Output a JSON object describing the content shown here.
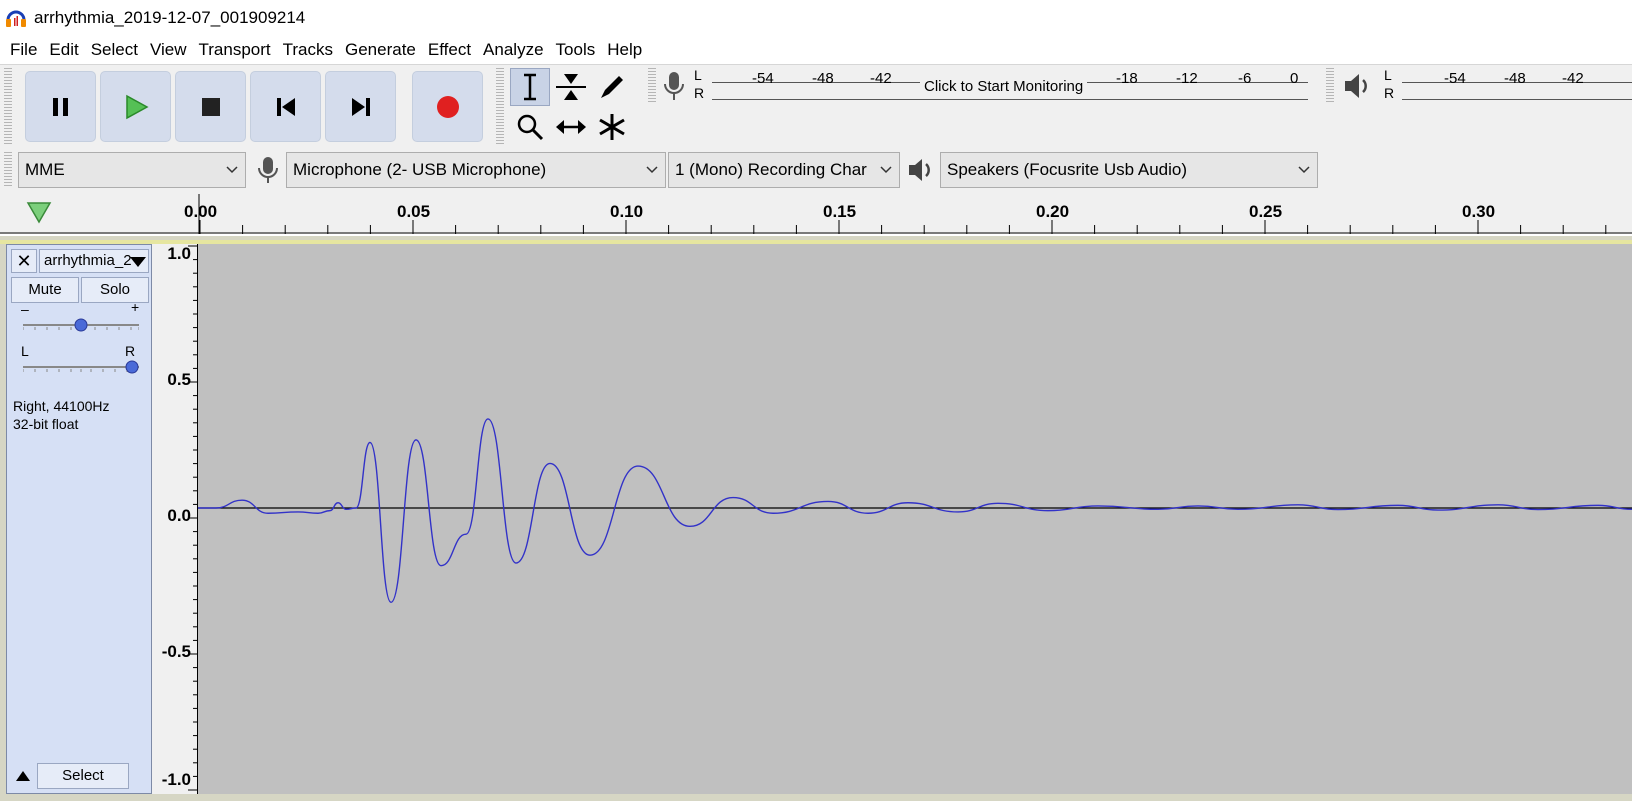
{
  "window": {
    "title": "arrhythmia_2019-12-07_001909214"
  },
  "menu": [
    "File",
    "Edit",
    "Select",
    "View",
    "Transport",
    "Tracks",
    "Generate",
    "Effect",
    "Analyze",
    "Tools",
    "Help"
  ],
  "transport": {
    "buttons": [
      {
        "name": "pause-button",
        "icon": "pause-icon"
      },
      {
        "name": "play-button",
        "icon": "play-icon"
      },
      {
        "name": "stop-button",
        "icon": "stop-icon"
      },
      {
        "name": "skip-to-start-button",
        "icon": "skip-start-icon"
      },
      {
        "name": "skip-to-end-button",
        "icon": "skip-end-icon"
      },
      {
        "name": "record-button",
        "icon": "record-icon"
      }
    ],
    "colors": {
      "play": "#3fa33f",
      "record": "#e02020",
      "button_bg": "#d4dcec"
    }
  },
  "tools": [
    "selection-tool",
    "envelope-tool",
    "draw-tool",
    "zoom-tool",
    "time-shift-tool",
    "multi-tool"
  ],
  "record_meter": {
    "l": "L",
    "r": "R",
    "ticks": [
      "-54",
      "-48",
      "-42",
      "-18",
      "-12",
      "-6",
      "0"
    ],
    "monitor_text": "Click to Start Monitoring"
  },
  "playback_meter": {
    "l": "L",
    "r": "R",
    "ticks": [
      "-54",
      "-48",
      "-42"
    ]
  },
  "devices": {
    "host": "MME",
    "input": "Microphone (2- USB Microphone)",
    "channels": "1 (Mono) Recording Char",
    "output": "Speakers (Focusrite Usb Audio)"
  },
  "ruler": {
    "labels": [
      "0.00",
      "0.05",
      "0.10",
      "0.15",
      "0.20",
      "0.25",
      "0.30"
    ]
  },
  "track": {
    "name": "arrhythmia_2",
    "mute": "Mute",
    "solo": "Solo",
    "gain_minus": "–",
    "gain_plus": "+",
    "pan_l": "L",
    "pan_r": "R",
    "gain": 0.5,
    "pan": 1.0,
    "info_line1": "Right, 44100Hz",
    "info_line2": "32-bit float",
    "select": "Select",
    "waveform_color": "#3232c8"
  },
  "vruler": {
    "labels": [
      "1.0",
      "0.5",
      "0.0",
      "-0.5",
      "-1.0"
    ]
  }
}
